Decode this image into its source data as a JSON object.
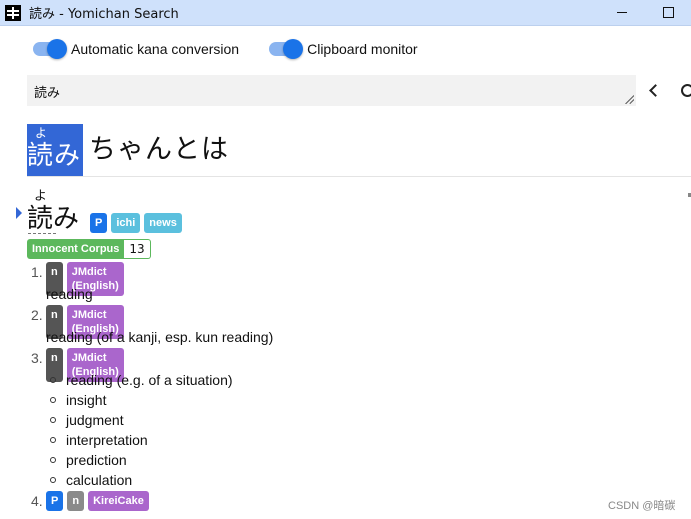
{
  "window": {
    "title": "読み - Yomichan Search"
  },
  "toggles": {
    "kana_label": "Automatic kana conversion",
    "clipboard_label": "Clipboard monitor"
  },
  "search": {
    "value": "読み"
  },
  "query": {
    "highlight_reading": "よ",
    "highlight_text": "読み",
    "rest_text": "ちゃんとは"
  },
  "entry": {
    "reading": "よ",
    "expression": "読み",
    "tags": [
      "P",
      "ichi",
      "news"
    ],
    "frequency": {
      "name": "Innocent Corpus",
      "value": "13"
    },
    "definitions": [
      {
        "number": "1.",
        "pos": "n",
        "dict": "JMdict (English)",
        "gloss": "reading"
      },
      {
        "number": "2.",
        "pos": "n",
        "dict": "JMdict (English)",
        "gloss": "reading (of a kanji, esp. kun reading)"
      },
      {
        "number": "3.",
        "pos": "n",
        "dict": "JMdict (English)",
        "glosses": [
          "reading (e.g. of a situation)",
          "insight",
          "judgment",
          "interpretation",
          "prediction",
          "calculation"
        ]
      },
      {
        "number": "4.",
        "tags": [
          "P",
          "n",
          "KireiCake"
        ]
      }
    ]
  },
  "watermark": "CSDN @暗碳"
}
